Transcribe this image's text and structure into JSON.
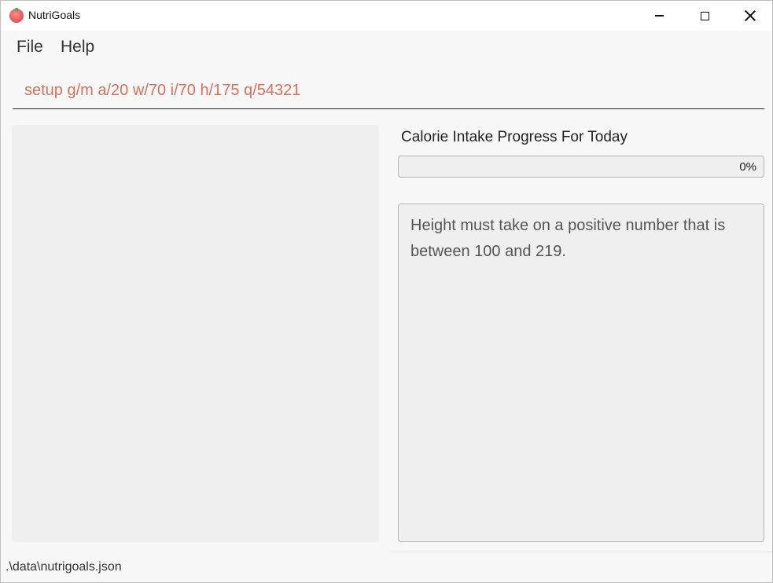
{
  "window": {
    "title": "NutriGoals",
    "icon": "tomato-icon",
    "controls": [
      "minimize-icon",
      "maximize-icon",
      "close-icon"
    ]
  },
  "menu": {
    "items": [
      "File",
      "Help"
    ]
  },
  "command": {
    "value": "setup g/m a/20 w/70 i/70 h/175 q/54321",
    "text_color": "#d9705c"
  },
  "progress": {
    "label": "Calorie Intake Progress For Today",
    "percent_text": "0%",
    "fraction": 0
  },
  "result": {
    "message": "Height must take on a positive number that is between 100 and 219."
  },
  "status": {
    "file_path": ".\\data\\nutrigoals.json"
  }
}
